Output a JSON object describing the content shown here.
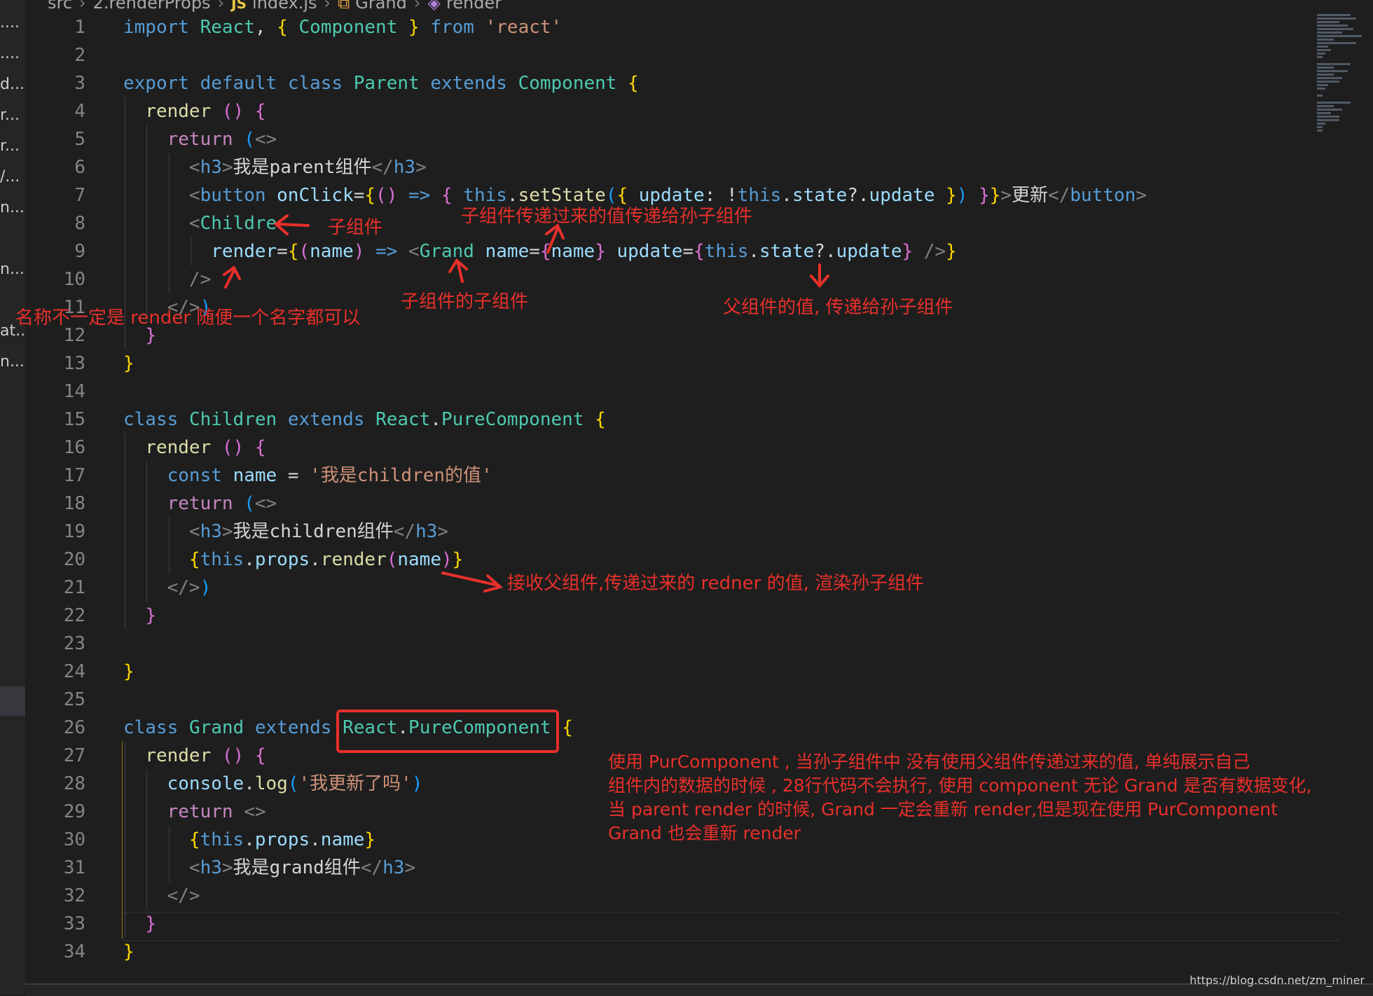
{
  "breadcrumb": {
    "src": "src",
    "folder": "2.renderProps",
    "file_badge": "JS",
    "file": "index.js",
    "class_name": "Grand",
    "method": "render"
  },
  "explorer": {
    "items": [
      "....",
      "....",
      "d...",
      "r...",
      "r...",
      "/...",
      "n...",
      "n...",
      "at...",
      "n..."
    ]
  },
  "code_lines": [
    [
      [
        "kw",
        "import"
      ],
      [
        "txt",
        " "
      ],
      [
        "cls",
        "React"
      ],
      [
        "txt",
        ", "
      ],
      [
        "b1",
        "{"
      ],
      [
        "txt",
        " "
      ],
      [
        "cls",
        "Component"
      ],
      [
        "txt",
        " "
      ],
      [
        "b1",
        "}"
      ],
      [
        "txt",
        " "
      ],
      [
        "kw",
        "from"
      ],
      [
        "txt",
        " "
      ],
      [
        "str",
        "'react'"
      ]
    ],
    [],
    [
      [
        "kw",
        "export"
      ],
      [
        "txt",
        " "
      ],
      [
        "kw",
        "default"
      ],
      [
        "txt",
        " "
      ],
      [
        "kw",
        "class"
      ],
      [
        "txt",
        " "
      ],
      [
        "cls",
        "Parent"
      ],
      [
        "txt",
        " "
      ],
      [
        "kw",
        "extends"
      ],
      [
        "txt",
        " "
      ],
      [
        "cls",
        "Component"
      ],
      [
        "txt",
        " "
      ],
      [
        "b1",
        "{"
      ]
    ],
    [
      [
        "txt",
        "  "
      ],
      [
        "fn",
        "render"
      ],
      [
        "txt",
        " "
      ],
      [
        "b2",
        "()"
      ],
      [
        "txt",
        " "
      ],
      [
        "b2",
        "{"
      ]
    ],
    [
      [
        "txt",
        "    "
      ],
      [
        "ctl",
        "return"
      ],
      [
        "txt",
        " "
      ],
      [
        "b3",
        "("
      ],
      [
        "pun",
        "<>"
      ]
    ],
    [
      [
        "txt",
        "      "
      ],
      [
        "pun",
        "<"
      ],
      [
        "tag",
        "h3"
      ],
      [
        "pun",
        ">"
      ],
      [
        "txt",
        "我是parent组件"
      ],
      [
        "pun",
        "</"
      ],
      [
        "tag",
        "h3"
      ],
      [
        "pun",
        ">"
      ]
    ],
    [
      [
        "txt",
        "      "
      ],
      [
        "pun",
        "<"
      ],
      [
        "tag",
        "button"
      ],
      [
        "txt",
        " "
      ],
      [
        "vr",
        "onClick"
      ],
      [
        "txt",
        "="
      ],
      [
        "b1",
        "{"
      ],
      [
        "b2",
        "()"
      ],
      [
        "txt",
        " "
      ],
      [
        "kw",
        "=>"
      ],
      [
        "txt",
        " "
      ],
      [
        "b2",
        "{"
      ],
      [
        "txt",
        " "
      ],
      [
        "kw",
        "this"
      ],
      [
        "txt",
        "."
      ],
      [
        "fn",
        "setState"
      ],
      [
        "b3",
        "("
      ],
      [
        "b1",
        "{"
      ],
      [
        "txt",
        " "
      ],
      [
        "vr",
        "update"
      ],
      [
        "txt",
        ": !"
      ],
      [
        "kw",
        "this"
      ],
      [
        "txt",
        "."
      ],
      [
        "vr",
        "state"
      ],
      [
        "txt",
        "?."
      ],
      [
        "vr",
        "update"
      ],
      [
        "txt",
        " "
      ],
      [
        "b1",
        "}"
      ],
      [
        "b3",
        ")"
      ],
      [
        "txt",
        " "
      ],
      [
        "b2",
        "}"
      ],
      [
        "b1",
        "}"
      ],
      [
        "pun",
        ">"
      ],
      [
        "txt",
        "更新"
      ],
      [
        "pun",
        "</"
      ],
      [
        "tag",
        "button"
      ],
      [
        "pun",
        ">"
      ]
    ],
    [
      [
        "txt",
        "      "
      ],
      [
        "pun",
        "<"
      ],
      [
        "cls",
        "Childre"
      ]
    ],
    [
      [
        "txt",
        "        "
      ],
      [
        "vr",
        "render"
      ],
      [
        "txt",
        "="
      ],
      [
        "b1",
        "{"
      ],
      [
        "b2",
        "("
      ],
      [
        "vr",
        "name"
      ],
      [
        "b2",
        ")"
      ],
      [
        "txt",
        " "
      ],
      [
        "kw",
        "=>"
      ],
      [
        "txt",
        " "
      ],
      [
        "pun",
        "<"
      ],
      [
        "cls",
        "Grand"
      ],
      [
        "txt",
        " "
      ],
      [
        "vr",
        "name"
      ],
      [
        "txt",
        "="
      ],
      [
        "b2",
        "{"
      ],
      [
        "vr",
        "name"
      ],
      [
        "b2",
        "}"
      ],
      [
        "txt",
        " "
      ],
      [
        "vr",
        "update"
      ],
      [
        "txt",
        "="
      ],
      [
        "b2",
        "{"
      ],
      [
        "kw",
        "this"
      ],
      [
        "txt",
        "."
      ],
      [
        "vr",
        "state"
      ],
      [
        "txt",
        "?."
      ],
      [
        "vr",
        "update"
      ],
      [
        "b2",
        "}"
      ],
      [
        "txt",
        " "
      ],
      [
        "pun",
        "/>"
      ],
      [
        "b1",
        "}"
      ]
    ],
    [
      [
        "txt",
        "      "
      ],
      [
        "pun",
        "/>"
      ]
    ],
    [
      [
        "txt",
        "    "
      ],
      [
        "pun",
        "</>"
      ],
      [
        "b3",
        ")"
      ]
    ],
    [
      [
        "txt",
        "  "
      ],
      [
        "b2",
        "}"
      ]
    ],
    [
      [
        "b1",
        "}"
      ]
    ],
    [],
    [
      [
        "kw",
        "class"
      ],
      [
        "txt",
        " "
      ],
      [
        "cls",
        "Children"
      ],
      [
        "txt",
        " "
      ],
      [
        "kw",
        "extends"
      ],
      [
        "txt",
        " "
      ],
      [
        "cls",
        "React"
      ],
      [
        "txt",
        "."
      ],
      [
        "cls",
        "PureComponent"
      ],
      [
        "txt",
        " "
      ],
      [
        "b1",
        "{"
      ]
    ],
    [
      [
        "txt",
        "  "
      ],
      [
        "fn",
        "render"
      ],
      [
        "txt",
        " "
      ],
      [
        "b2",
        "()"
      ],
      [
        "txt",
        " "
      ],
      [
        "b2",
        "{"
      ]
    ],
    [
      [
        "txt",
        "    "
      ],
      [
        "kw",
        "const"
      ],
      [
        "txt",
        " "
      ],
      [
        "vr",
        "name"
      ],
      [
        "txt",
        " = "
      ],
      [
        "str",
        "'我是children的值'"
      ]
    ],
    [
      [
        "txt",
        "    "
      ],
      [
        "ctl",
        "return"
      ],
      [
        "txt",
        " "
      ],
      [
        "b3",
        "("
      ],
      [
        "pun",
        "<>"
      ]
    ],
    [
      [
        "txt",
        "      "
      ],
      [
        "pun",
        "<"
      ],
      [
        "tag",
        "h3"
      ],
      [
        "pun",
        ">"
      ],
      [
        "txt",
        "我是children组件"
      ],
      [
        "pun",
        "</"
      ],
      [
        "tag",
        "h3"
      ],
      [
        "pun",
        ">"
      ]
    ],
    [
      [
        "txt",
        "      "
      ],
      [
        "b1",
        "{"
      ],
      [
        "kw",
        "this"
      ],
      [
        "txt",
        "."
      ],
      [
        "vr",
        "props"
      ],
      [
        "txt",
        "."
      ],
      [
        "fn",
        "render"
      ],
      [
        "b2",
        "("
      ],
      [
        "vr",
        "name"
      ],
      [
        "b2",
        ")"
      ],
      [
        "b1",
        "}"
      ]
    ],
    [
      [
        "txt",
        "    "
      ],
      [
        "pun",
        "</>"
      ],
      [
        "b3",
        ")"
      ]
    ],
    [
      [
        "txt",
        "  "
      ],
      [
        "b2",
        "}"
      ]
    ],
    [],
    [
      [
        "b1",
        "}"
      ]
    ],
    [],
    [
      [
        "kw",
        "class"
      ],
      [
        "txt",
        " "
      ],
      [
        "cls",
        "Grand"
      ],
      [
        "txt",
        " "
      ],
      [
        "kw",
        "extends"
      ],
      [
        "txt",
        " "
      ],
      [
        "cls",
        "React"
      ],
      [
        "txt",
        "."
      ],
      [
        "cls",
        "PureComponent"
      ],
      [
        "txt",
        " "
      ],
      [
        "b1",
        "{"
      ]
    ],
    [
      [
        "txt",
        "  "
      ],
      [
        "fn",
        "render"
      ],
      [
        "txt",
        " "
      ],
      [
        "b2",
        "()"
      ],
      [
        "txt",
        " "
      ],
      [
        "b2",
        "{"
      ]
    ],
    [
      [
        "txt",
        "    "
      ],
      [
        "vr",
        "console"
      ],
      [
        "txt",
        "."
      ],
      [
        "fn",
        "log"
      ],
      [
        "b3",
        "("
      ],
      [
        "str",
        "'我更新了吗'"
      ],
      [
        "b3",
        ")"
      ]
    ],
    [
      [
        "txt",
        "    "
      ],
      [
        "ctl",
        "return"
      ],
      [
        "txt",
        " "
      ],
      [
        "pun",
        "<>"
      ]
    ],
    [
      [
        "txt",
        "      "
      ],
      [
        "b1",
        "{"
      ],
      [
        "kw",
        "this"
      ],
      [
        "txt",
        "."
      ],
      [
        "vr",
        "props"
      ],
      [
        "txt",
        "."
      ],
      [
        "vr",
        "name"
      ],
      [
        "b1",
        "}"
      ]
    ],
    [
      [
        "txt",
        "      "
      ],
      [
        "pun",
        "<"
      ],
      [
        "tag",
        "h3"
      ],
      [
        "pun",
        ">"
      ],
      [
        "txt",
        "我是grand组件"
      ],
      [
        "pun",
        "</"
      ],
      [
        "tag",
        "h3"
      ],
      [
        "pun",
        ">"
      ]
    ],
    [
      [
        "txt",
        "    "
      ],
      [
        "pun",
        "</>"
      ]
    ],
    [
      [
        "txt",
        "  "
      ],
      [
        "b2",
        "}"
      ]
    ],
    [
      [
        "b1",
        "}"
      ]
    ]
  ],
  "annotations": {
    "child_component": "子组件",
    "pass_to_grandchild": "子组件传递过来的值传递给孙子组件",
    "grandchild_of_child": "子组件的子组件",
    "parent_value": "父组件的值, 传递给孙子组件",
    "name_not_render": "名称不一定是 render 随便一个名字都可以",
    "receive_parent": "接收父组件,传递过来的 redner 的值, 渲染孙子组件",
    "pure_note": [
      "使用 PurComponent , 当孙子组件中 没有使用父组件传递过来的值, 单纯展示自己",
      "组件内的数据的时候 , 28行代码不会执行, 使用 component 无论 Grand 是否有数据变化,",
      "当 parent render 的时候, Grand 一定会重新 render,但是现在使用 PurComponent",
      "Grand 也会重新 render"
    ]
  },
  "watermark": "https://blog.csdn.net/zm_miner",
  "colors": {
    "background": "#1e1e1e",
    "annotation_red": "#e8302a",
    "keyword": "#569cd6",
    "class": "#4ec9b0",
    "string": "#ce9178"
  }
}
